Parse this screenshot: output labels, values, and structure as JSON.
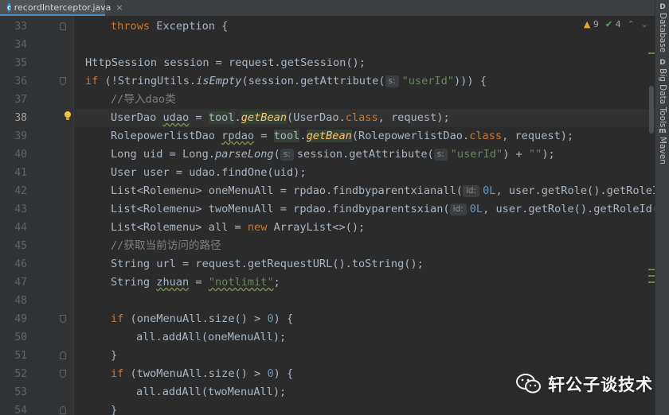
{
  "tab": {
    "filename": "recordInterceptor.java",
    "close": "×",
    "file_icon": "c"
  },
  "inspections": {
    "warnings": "9",
    "ok": "4",
    "up": "⌃",
    "down": "⌄"
  },
  "right_tools": [
    {
      "icon": "D",
      "label": "Database"
    },
    {
      "icon": "D",
      "label": "Big Data Tools"
    },
    {
      "icon": "m",
      "label": "Maven"
    }
  ],
  "lines": [
    {
      "n": "33",
      "fold": "up"
    },
    {
      "n": "34"
    },
    {
      "n": "35"
    },
    {
      "n": "36",
      "fold": "down"
    },
    {
      "n": "37"
    },
    {
      "n": "38",
      "current": true,
      "bulb": true
    },
    {
      "n": "39"
    },
    {
      "n": "40"
    },
    {
      "n": "41"
    },
    {
      "n": "42"
    },
    {
      "n": "43"
    },
    {
      "n": "44"
    },
    {
      "n": "45"
    },
    {
      "n": "46"
    },
    {
      "n": "47"
    },
    {
      "n": "48"
    },
    {
      "n": "49",
      "fold": "down"
    },
    {
      "n": "50"
    },
    {
      "n": "51",
      "fold": "up"
    },
    {
      "n": "52",
      "fold": "down"
    },
    {
      "n": "53"
    },
    {
      "n": "54",
      "fold": "up"
    }
  ],
  "code": {
    "l33": {
      "throws": "throws",
      "rest": " Exception {"
    },
    "l35": {
      "text": "HttpSession session = request.getSession();"
    },
    "l36": {
      "if": "if",
      "a": " (!StringUtils.",
      "isEmpty": "isEmpty",
      "b": "(session.getAttribute(",
      "hint": "s:",
      "userId": "\"userId\"",
      "c": "))) {"
    },
    "l37": {
      "comment": "//导入dao类"
    },
    "l38": {
      "a": "UserDao ",
      "var": "udao",
      "b": " = ",
      "tool": "tool",
      "dot": ".",
      "getBean": "getBean",
      "c": "(UserDao.",
      "cls": "class",
      "d": ", request);"
    },
    "l39": {
      "a": "RolepowerlistDao ",
      "var": "rpdao",
      "b": " = ",
      "tool": "tool",
      "dot": ".",
      "getBean": "getBean",
      "c": "(RolepowerlistDao.",
      "cls": "class",
      "d": ", request);"
    },
    "l40": {
      "a": "Long uid = Long.",
      "parseLong": "parseLong",
      "b": "(",
      "hint": "s:",
      "c": "session.getAttribute(",
      "hint2": "s:",
      "userId": "\"userId\"",
      "d": ") + ",
      "empty": "\"\"",
      "e": ");"
    },
    "l41": {
      "text": "User user = udao.findOne(uid);"
    },
    "l42": {
      "a": "List<Rolemenu> oneMenuAll = rpdao.findbyparentxianall(",
      "hint": "id:",
      "zero": "0L",
      "b": ", user.getRole().getRoleId"
    },
    "l43": {
      "a": "List<Rolemenu> twoMenuAll = rpdao.findbyparentsxian(",
      "hint": "id:",
      "zero": "0L",
      "b": ", user.getRole().getRoleId()"
    },
    "l44": {
      "a": "List<Rolemenu> all = ",
      "new": "new",
      "b": " ArrayList<>();"
    },
    "l45": {
      "comment": "//获取当前访问的路径"
    },
    "l46": {
      "text": "String url = request.getRequestURL().toString();"
    },
    "l47": {
      "a": "String ",
      "var": "zhuan",
      "b": " = ",
      "str": "\"notlimit\"",
      "c": ";"
    },
    "l49": {
      "if": "if",
      "a": " (oneMenuAll.size() > ",
      "zero": "0",
      "b": ") {"
    },
    "l50": {
      "text": "all.addAll(oneMenuAll);"
    },
    "l51": {
      "text": "}"
    },
    "l52": {
      "if": "if",
      "a": " (twoMenuAll.size() > ",
      "zero": "0",
      "b": ") {"
    },
    "l53": {
      "text": "all.addAll(twoMenuAll);"
    },
    "l54": {
      "text": "}"
    }
  },
  "watermark": {
    "text": "轩公子谈技术"
  },
  "colors": {
    "keyword": "#cc7832",
    "string": "#6a8759",
    "number": "#6897bb",
    "comment": "#808080",
    "method_italic": "#ffc66d",
    "text": "#a9b7c6"
  }
}
